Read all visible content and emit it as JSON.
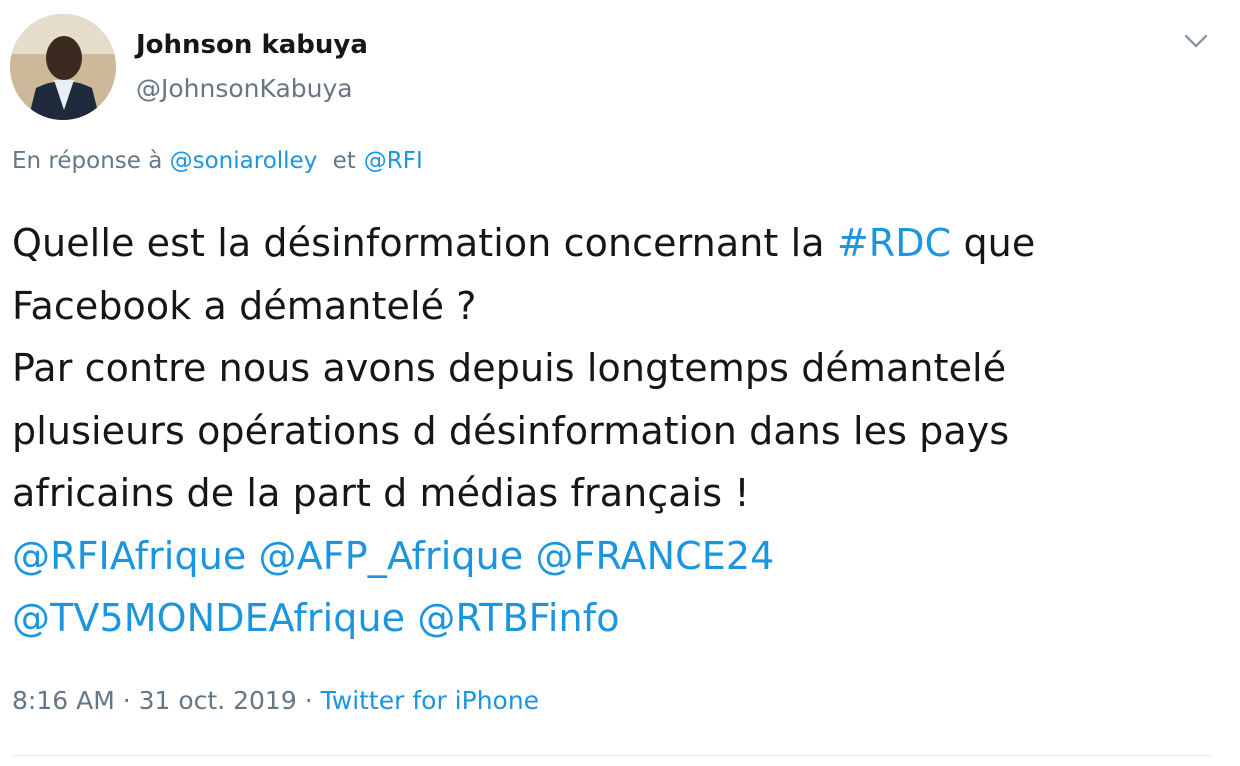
{
  "author": {
    "display_name": "Johnson kabuya",
    "handle": "@JohnsonKabuya",
    "avatar_icon": "user-avatar"
  },
  "reply": {
    "prefix": "En réponse à",
    "mention_1": "@soniarolley",
    "joiner": "et",
    "mention_2": "@RFI"
  },
  "tweet": {
    "line_1_before": "Quelle est la désinformation concernant la ",
    "hashtag": "#RDC",
    "line_1_after": " que",
    "line_2": "Facebook a démantelé ?",
    "line_3": "Par contre nous avons depuis longtemps démantelé",
    "line_4": "plusieurs opérations d désinformation dans les pays",
    "line_5": "africains de la part d médias français !",
    "mentions_line_1": [
      "@RFIAfrique",
      "@AFP_Afrique",
      "@FRANCE24"
    ],
    "mentions_line_2": [
      "@TV5MONDEAfrique",
      "@RTBFinfo"
    ]
  },
  "meta": {
    "time": "8:16 AM",
    "separator": "·",
    "date": "31 oct. 2019",
    "source": "Twitter for iPhone"
  },
  "colors": {
    "text": "#14171a",
    "secondary": "#657786",
    "link": "#1b95e0"
  },
  "icons": {
    "menu": "chevron-down-icon"
  }
}
